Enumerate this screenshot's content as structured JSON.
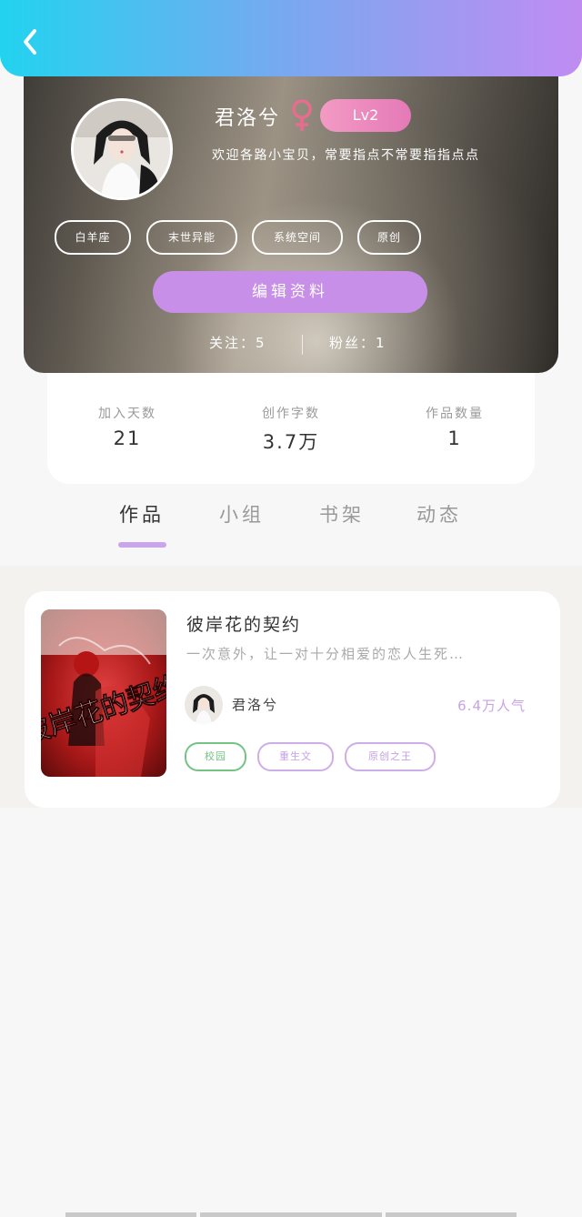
{
  "header": {
    "back_icon": "chevron-left-icon"
  },
  "profile": {
    "username": "君洛兮",
    "gender_icon": "female-icon",
    "gender_color": "#e66d8e",
    "level": "Lv2",
    "bio": "欢迎各路小宝贝，常要指点不常要指指点点",
    "tags": [
      "白羊座",
      "末世异能",
      "系统空间",
      "原创"
    ],
    "edit_button": "编辑资料",
    "follow_text": "关注：5",
    "fans_text": "粉丝：1"
  },
  "stats": [
    {
      "label": "加入天数",
      "value": "21"
    },
    {
      "label": "创作字数",
      "value": "3.7万"
    },
    {
      "label": "作品数量",
      "value": "1"
    }
  ],
  "tabs": [
    {
      "label": "作品",
      "active": true
    },
    {
      "label": "小组",
      "active": false
    },
    {
      "label": "书架",
      "active": false
    },
    {
      "label": "动态",
      "active": false
    }
  ],
  "works": [
    {
      "title": "彼岸花的契约",
      "description": "一次意外，让一对十分相爱的恋人生死…",
      "cover_text": "彼岸花的契约",
      "author": "君洛兮",
      "popularity": "6.4万人气",
      "tags": [
        {
          "label": "校园",
          "color": "#74c383"
        },
        {
          "label": "重生文",
          "color": "#c4a2e3"
        },
        {
          "label": "原创之王",
          "color": "#c4a2e3"
        }
      ]
    }
  ],
  "colors": {
    "header_gradient_start": "#22d3f0",
    "header_gradient_end": "#c08cf2",
    "accent_purple": "#c88fe9"
  }
}
